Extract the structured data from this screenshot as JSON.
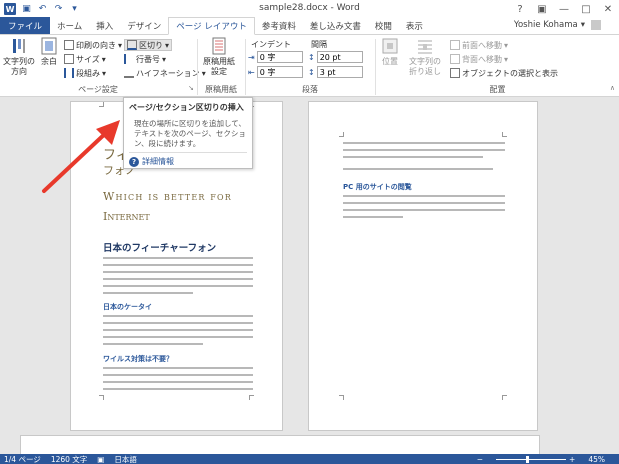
{
  "app": {
    "title": "sample28.docx - Word",
    "user": "Yoshie Kohama",
    "help_glyph": "?"
  },
  "tabs": [
    {
      "label": "ファイル"
    },
    {
      "label": "ホーム"
    },
    {
      "label": "挿入"
    },
    {
      "label": "デザイン"
    },
    {
      "label": "ページ レイアウト"
    },
    {
      "label": "参考資料"
    },
    {
      "label": "差し込み文書"
    },
    {
      "label": "校閲"
    },
    {
      "label": "表示"
    }
  ],
  "ribbon": {
    "page_setup": {
      "label": "ページ設定",
      "text_direction": "文字列の\n方向",
      "margins": "余白",
      "orientation": "印刷の向き",
      "size": "サイズ",
      "columns": "段組み",
      "breaks": "区切り",
      "line_numbers": "行番号",
      "hyphenation": "ハイフネーション"
    },
    "paper": {
      "label": "原稿用紙",
      "button": "原稿用紙\n設定"
    },
    "paragraph": {
      "label": "段落",
      "indent_label": "インデント",
      "spacing_label": "間隔",
      "indent_left": "0 字",
      "indent_right": "0 字",
      "spacing_before": "20 pt",
      "spacing_after": "3 pt"
    },
    "arrange": {
      "label": "配置",
      "position": "位置",
      "wrap": "文字列の\n折り返し",
      "bring_forward": "前面へ移動",
      "send_backward": "背面へ移動",
      "selection_pane": "オブジェクトの選択と表示"
    }
  },
  "tooltip": {
    "title": "ページ/セクション区切りの挿入",
    "body": "現在の場所に区切りを追加して、テキストを次のページ、セクション、段に続けます。",
    "link": "詳細情報"
  },
  "page1": {
    "title1": "フィ",
    "title2": "フォノ",
    "title3": "Which is better for",
    "title4": "Internet",
    "heading1": "日本のフィーチャーフォン",
    "heading2": "日本のケータイ",
    "heading3": "ワイルス対策は不要？"
  },
  "page2": {
    "heading1": "PC 用のサイトの閲覧"
  },
  "status": {
    "page": "1/4 ページ",
    "words": "1260 文字",
    "lang": "日本語",
    "zoom": "45%"
  },
  "colors": {
    "accent": "#2b579a",
    "arrow": "#e8392b",
    "title_gold": "#7a6a40"
  }
}
